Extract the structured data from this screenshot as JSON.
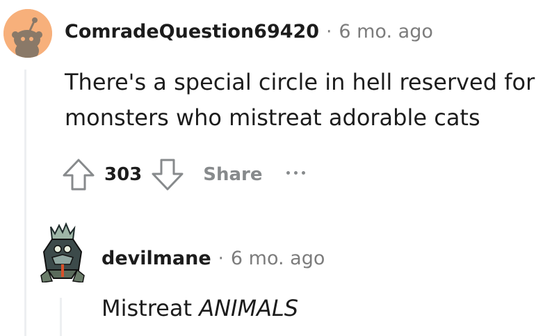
{
  "comment_1": {
    "username": "ComradeQuestion69420",
    "separator": "·",
    "time": "6 mo. ago",
    "body": "There's a special circle in hell reserved for monsters who mistreat adorable cats",
    "vote_count": "303",
    "share_label": "Share",
    "avatar_icon": "snoo-avatar-icon",
    "avatar_color": "#f7b07b"
  },
  "comment_2": {
    "username": "devilmane",
    "separator": "·",
    "time": "6 mo. ago",
    "body_prefix": "Mistreat",
    "body_emphasis": "ANIMALS",
    "avatar_icon": "armored-character-avatar-icon"
  },
  "colors": {
    "text": "#1c1c1c",
    "meta": "#7c7c7c",
    "action": "#878a8c",
    "thread_line": "#edeff1"
  }
}
